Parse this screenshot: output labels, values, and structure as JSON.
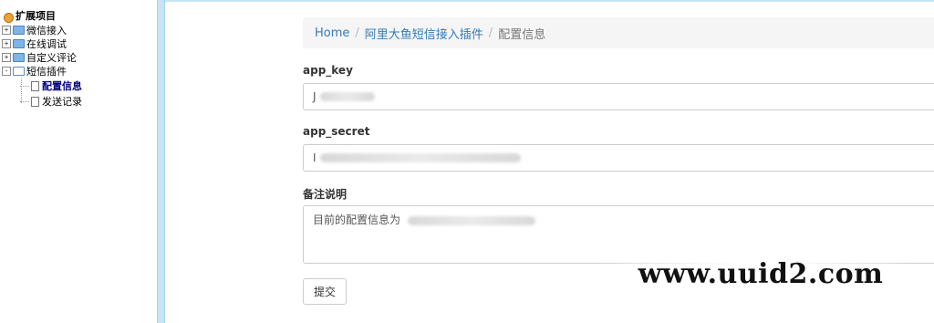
{
  "tree": {
    "root_label": "扩展项目",
    "items": [
      {
        "label": "微信接入",
        "expand": "+"
      },
      {
        "label": "在线调试",
        "expand": "+"
      },
      {
        "label": "自定义评论",
        "expand": "+"
      },
      {
        "label": "短信插件",
        "expand": "-"
      }
    ],
    "children": [
      {
        "label": "配置信息",
        "selected": true
      },
      {
        "label": "发送记录",
        "selected": false
      }
    ]
  },
  "breadcrumb": {
    "home": "Home",
    "plugin": "阿里大鱼短信接入插件",
    "current": "配置信息",
    "separator": "/"
  },
  "form": {
    "app_key_label": "app_key",
    "app_key_value": "J",
    "app_secret_label": "app_secret",
    "app_secret_value": "I",
    "note_label": "备注说明",
    "note_value": "目前的配置信息为",
    "submit_label": "提交"
  },
  "watermark": "www.uuid2.com"
}
